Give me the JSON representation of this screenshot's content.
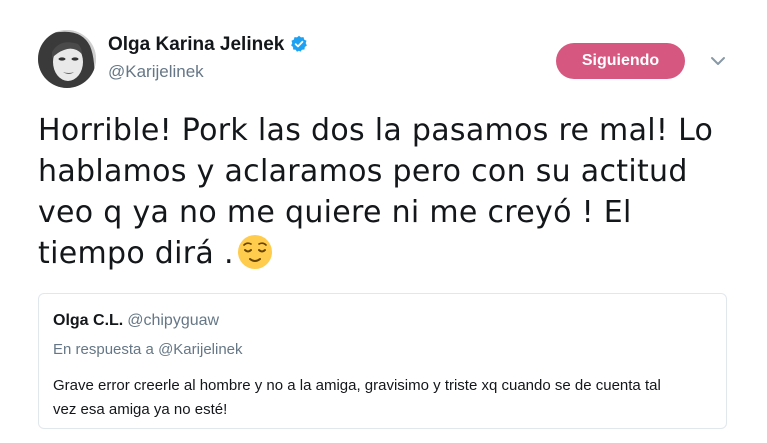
{
  "author": {
    "display_name": "Olga Karina Jelinek",
    "handle": "@Karijelinek",
    "verified": true
  },
  "follow_button": {
    "label": "Siguiendo",
    "color": "#d6577f"
  },
  "menu_icon": "chevron-down-icon",
  "tweet": {
    "text": "Horrible! Pork las dos la pasamos re mal! Lo hablamos y aclaramos pero con su actitud veo q ya no me quiere ni me creyó ! El tiempo dirá .",
    "emoji": "relieved-face-emoji"
  },
  "quoted_tweet": {
    "display_name": "Olga C.L.",
    "handle": "@chipyguaw",
    "reply_prefix": "En respuesta a",
    "reply_to": "@Karijelinek",
    "text": "Grave error creerle al hombre y no a la amiga, gravisimo y triste xq cuando se de cuenta tal vez esa amiga ya no esté!"
  },
  "colors": {
    "verified": "#1da1f2",
    "secondary_text": "#657786",
    "card_border": "#e1e8ed"
  }
}
